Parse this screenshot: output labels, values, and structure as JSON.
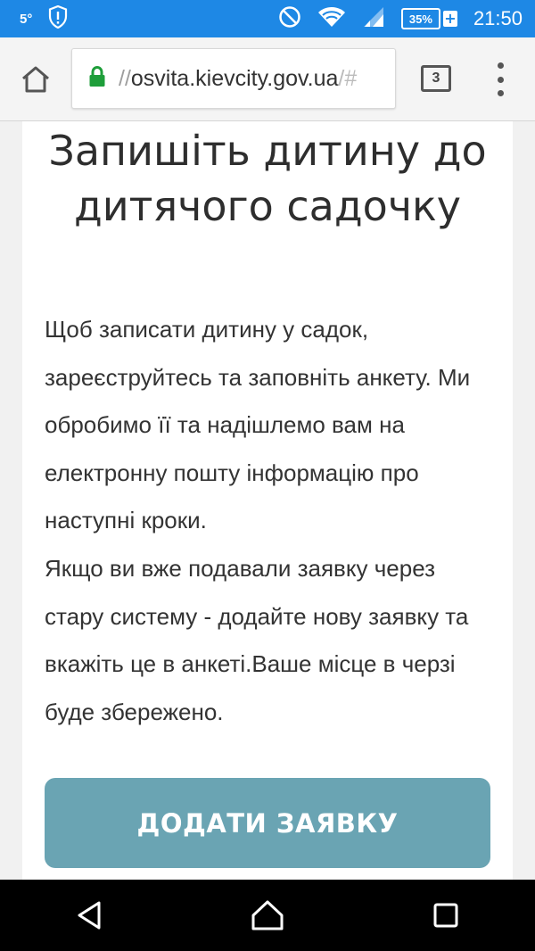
{
  "status_bar": {
    "temperature": "5°",
    "battery_percent": "35%",
    "battery_charging_symbol": "+",
    "time": "21:50",
    "icons": [
      "alert-shield-icon",
      "do-not-disturb-icon",
      "wifi-icon",
      "cell-signal-icon",
      "battery-icon"
    ]
  },
  "browser": {
    "url_prefix": "//",
    "url_host": "osvita.kievcity.gov.ua",
    "url_tail": "/#",
    "tab_count": "3",
    "secure_color": "#1e9e3a"
  },
  "page": {
    "heading": "Запишіть дитину до дитячого садочку",
    "paragraph_1": "Щоб записати дитину у садок, зареєструйтесь та заповніть анкету. Ми обробимо її та надішлемо вам на електронну пошту інформацію про наступні кроки.",
    "paragraph_2": "Якщо ви вже подавали заявку через стару систему - додайте нову заявку та вкажіть це в анкеті.Ваше місце в черзі буде збережено.",
    "cta_label": "ДОДАТИ ЗАЯВКУ",
    "cta_color": "#6aa4b3"
  },
  "colors": {
    "status_bar": "#1e88e5",
    "nav_bar": "#000000"
  }
}
